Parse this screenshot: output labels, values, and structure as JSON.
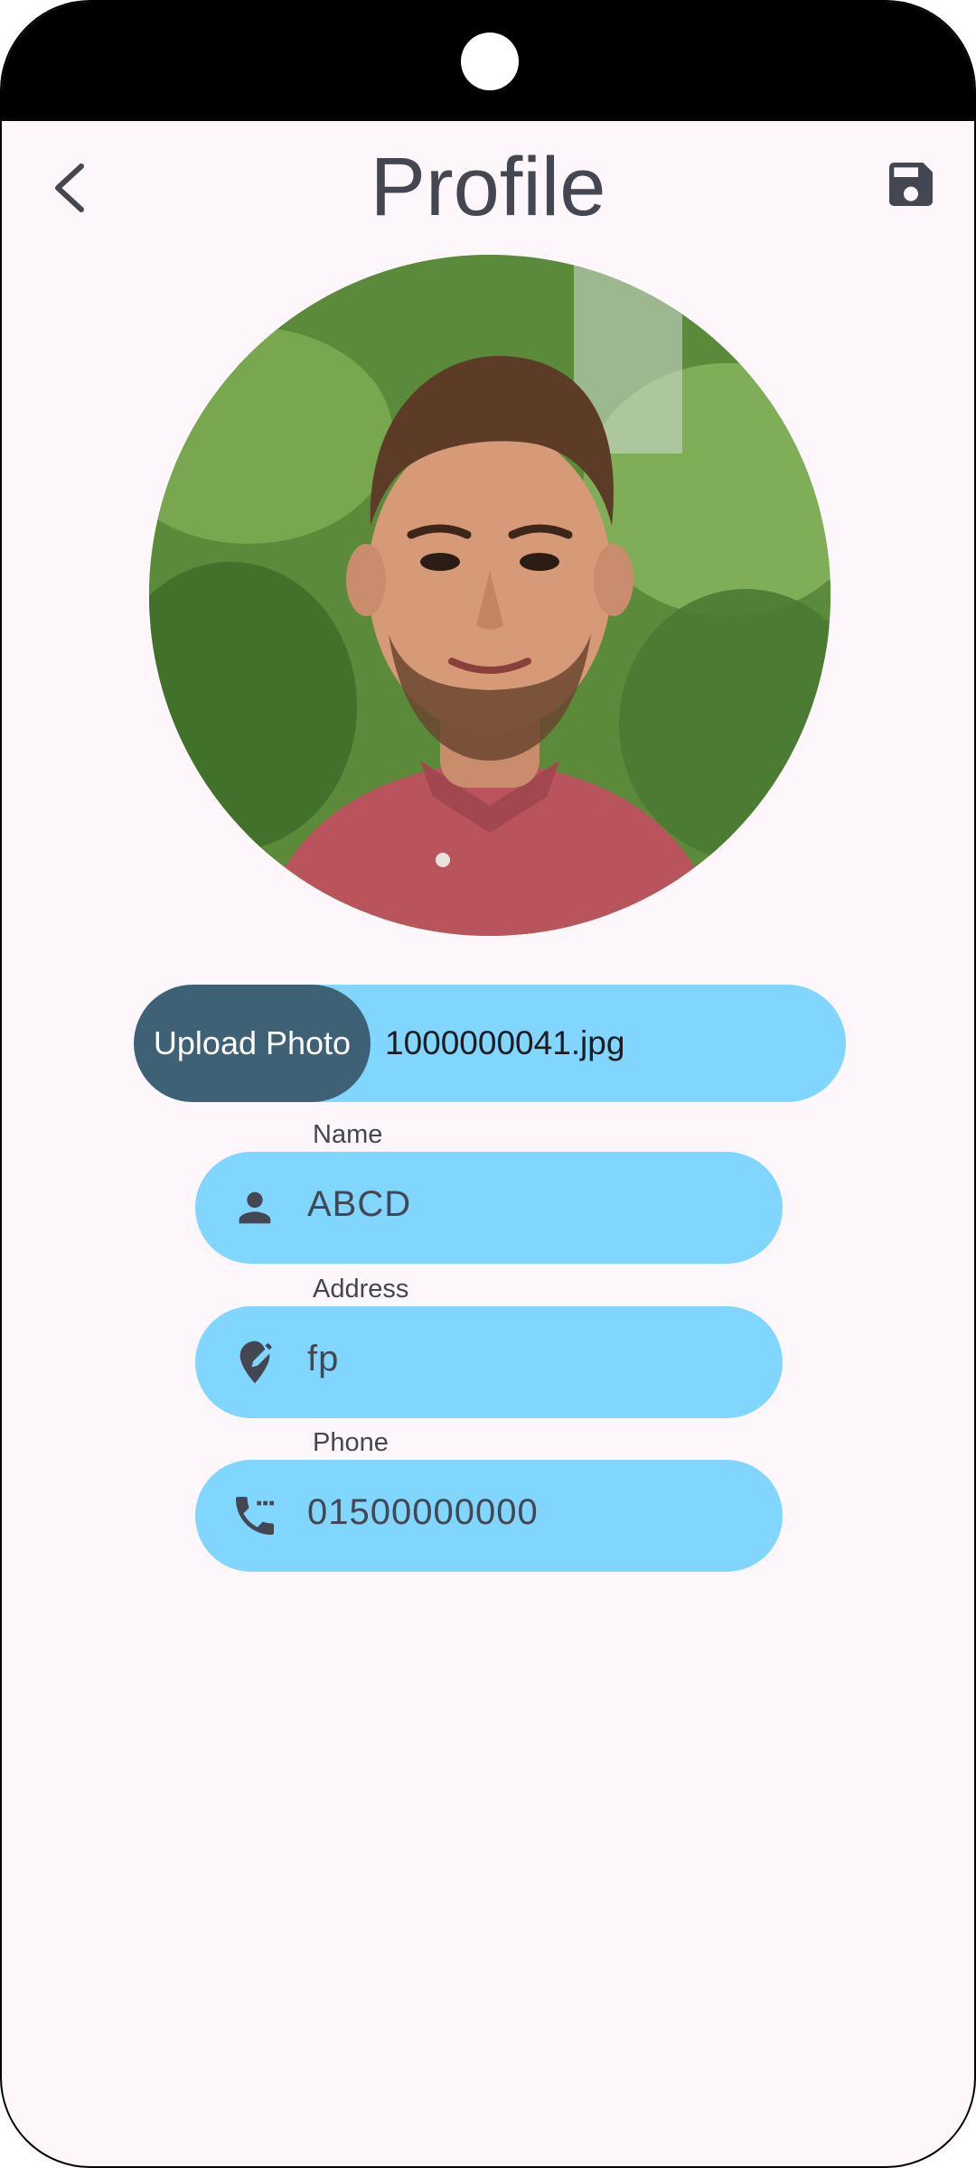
{
  "header": {
    "title": "Profile",
    "back_icon": "chevron-left-icon",
    "save_icon": "floppy-disk-icon"
  },
  "profile": {
    "avatar": "profile-photo"
  },
  "upload": {
    "button_label": "Upload Photo",
    "file_name": "1000000041.jpg"
  },
  "form": {
    "name": {
      "label": "Name",
      "value": "ABCD",
      "icon": "person-icon"
    },
    "address": {
      "label": "Address",
      "value": "fp",
      "icon": "edit-location-icon"
    },
    "phone": {
      "label": "Phone",
      "value": "01500000000",
      "icon": "phone-icon"
    }
  },
  "colors": {
    "background": "#fdf7fb",
    "field_fill": "#80d6ff",
    "upload_button": "#3e6176",
    "text": "#444651"
  }
}
